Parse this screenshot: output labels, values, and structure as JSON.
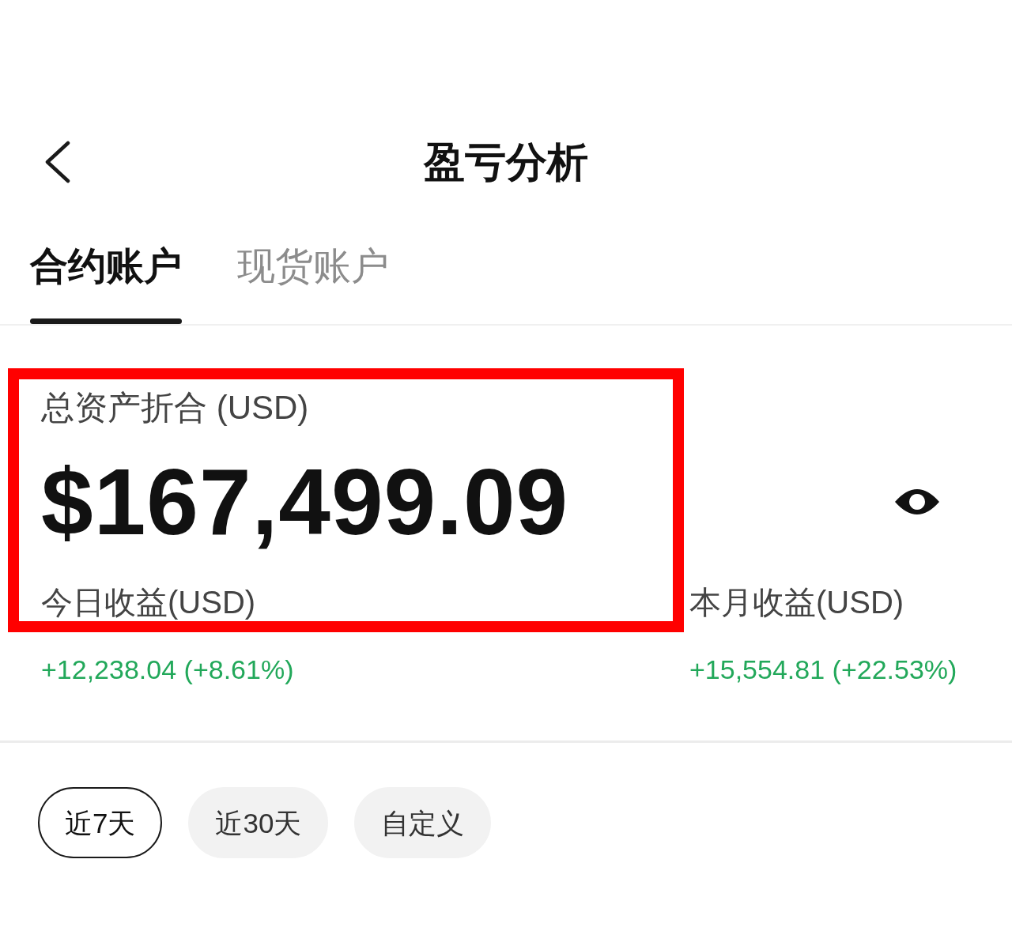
{
  "header": {
    "title": "盈亏分析"
  },
  "tabs": [
    {
      "label": "合约账户",
      "selected": true
    },
    {
      "label": "现货账户",
      "selected": false
    }
  ],
  "total_assets": {
    "label": "总资产折合 (USD)",
    "value": "$167,499.09",
    "highlighted": true
  },
  "earnings": [
    {
      "label": "今日收益(USD)",
      "value": "+12,238.04 (+8.61%)"
    },
    {
      "label": "本月收益(USD)",
      "value": "+15,554.81 (+22.53%)"
    }
  ],
  "periods": [
    {
      "label": "近7天",
      "selected": true
    },
    {
      "label": "近30天",
      "selected": false
    },
    {
      "label": "自定义",
      "selected": false
    }
  ]
}
